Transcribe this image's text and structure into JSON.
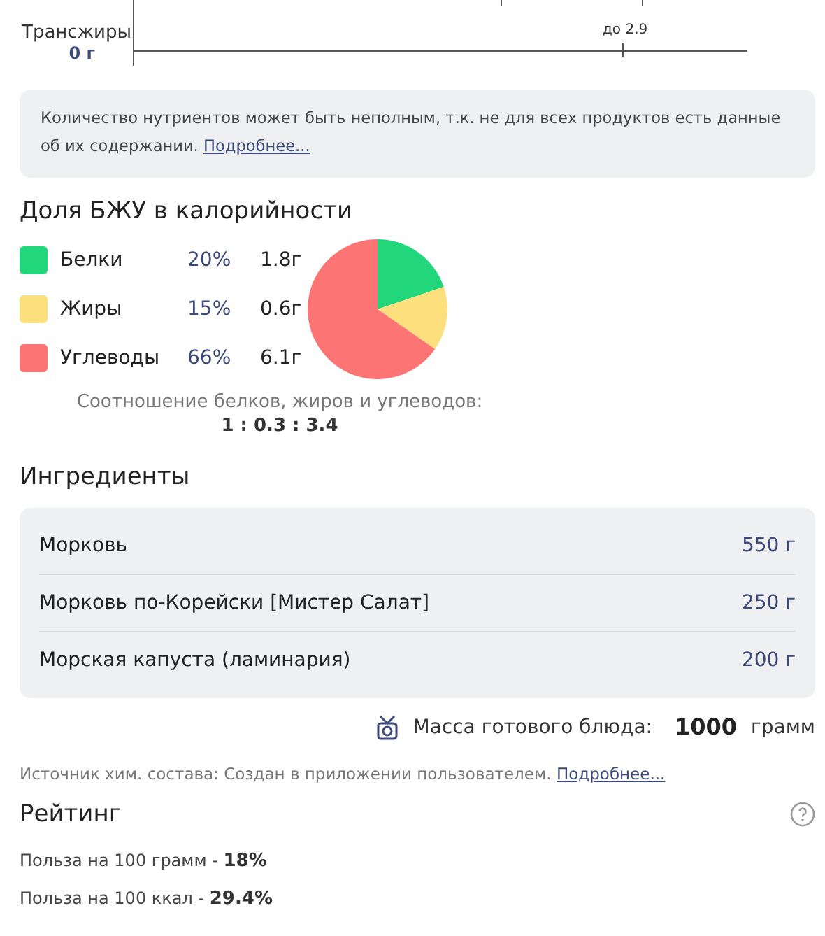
{
  "nutrient_chart": {
    "row": {
      "label": "Трансжиры",
      "value": "0 г",
      "limit": "до 2.9"
    }
  },
  "notice": {
    "text": "Количество нутриентов может быть неполным, т.к. не для всех продуктов есть данные об их содержании.",
    "link": "Подробнее..."
  },
  "macros": {
    "title": "Доля БЖУ в калорийности",
    "items": [
      {
        "name": "Белки",
        "percent": "20%",
        "grams": "1.8г",
        "color": "#22d77b"
      },
      {
        "name": "Жиры",
        "percent": "15%",
        "grams": "0.6г",
        "color": "#fedf7d"
      },
      {
        "name": "Углеводы",
        "percent": "66%",
        "grams": "6.1г",
        "color": "#fc7474"
      }
    ],
    "chart_data": {
      "type": "pie",
      "values": [
        20,
        15,
        66
      ]
    },
    "ratio_label": "Соотношение белков, жиров и углеводов:",
    "ratio": "1 : 0.3 : 3.4"
  },
  "ingredients": {
    "title": "Ингредиенты",
    "items": [
      {
        "name": "Морковь",
        "amount": "550 г"
      },
      {
        "name": "Морковь по-Корейски [Мистер Салат]",
        "amount": "250 г"
      },
      {
        "name": "Морская капуста (ламинария)",
        "amount": "200 г"
      }
    ]
  },
  "mass": {
    "label": "Масса готового блюда:",
    "value": "1000",
    "unit": "грамм"
  },
  "source": {
    "text": "Источник хим. состава: Создан в приложении пользователем.",
    "link": "Подробнее..."
  },
  "rating": {
    "title": "Рейтинг",
    "lines": [
      {
        "label": "Польза на 100 грамм - ",
        "value": "18%"
      },
      {
        "label": "Польза на 100 ккал - ",
        "value": "29.4%"
      }
    ]
  }
}
